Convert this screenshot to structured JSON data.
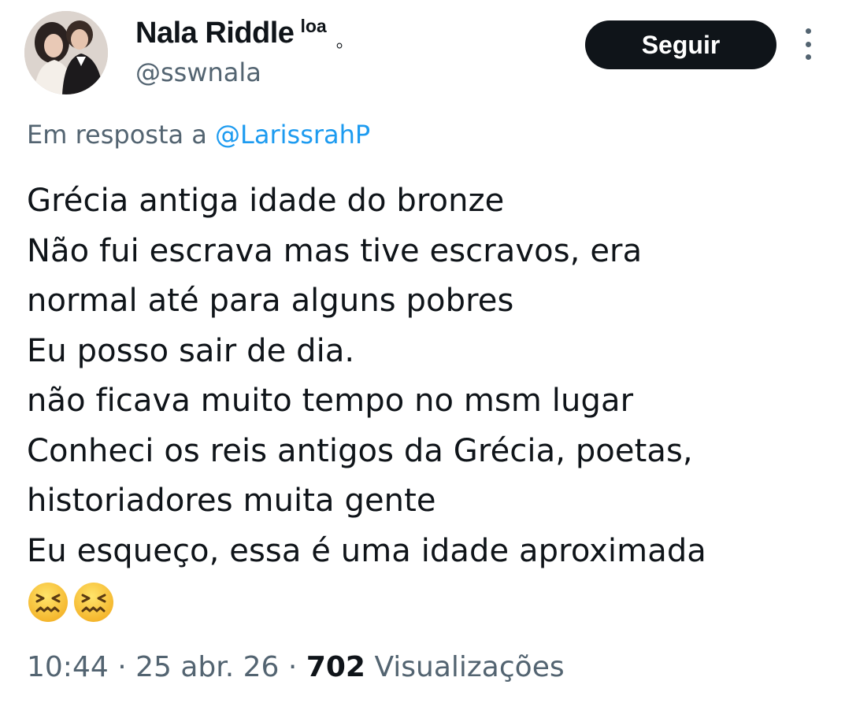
{
  "author": {
    "display_name": "Nala Riddle",
    "name_suffix": "loa",
    "name_dot": "。",
    "handle": "@sswnala"
  },
  "actions": {
    "follow_label": "Seguir"
  },
  "reply": {
    "prefix": "Em resposta a",
    "mention": "@LarissrahP"
  },
  "tweet": {
    "lines": [
      "Grécia antiga idade do bronze",
      "Não fui escrava mas tive escravos, era",
      "normal até para alguns pobres",
      "Eu posso sair de dia.",
      "não ficava muito tempo no msm lugar",
      "Conheci os reis antigos da Grécia, poetas,",
      "historiadores muita gente",
      "Eu esqueço, essa é uma idade aproximada"
    ],
    "emojis": [
      "confounded-face-emoji",
      "confounded-face-emoji"
    ]
  },
  "meta": {
    "time": "10:44",
    "separator": "·",
    "date": "25 abr. 26",
    "views_count": "702",
    "views_label": "Visualizações"
  },
  "colors": {
    "text": "#0f1419",
    "secondary": "#536471",
    "link": "#1d9bf0",
    "button_bg": "#0f1419"
  }
}
